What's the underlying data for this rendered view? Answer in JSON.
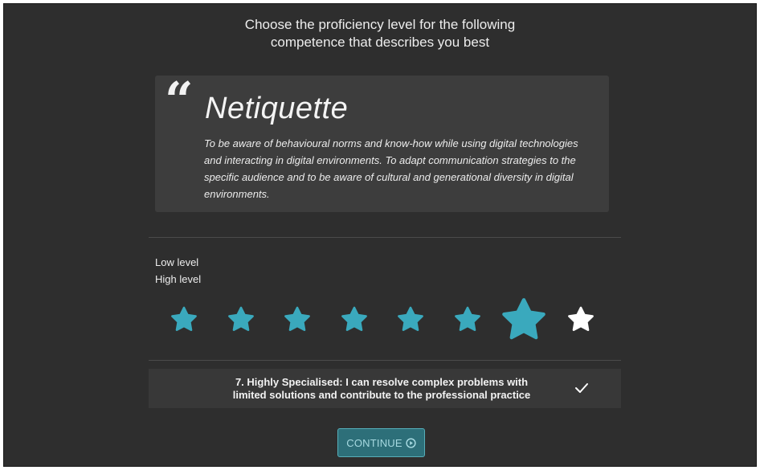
{
  "heading": {
    "line1": "Choose the proficiency level for the following",
    "line2": "competence that describes you best"
  },
  "competence": {
    "quote_icon": "quote-icon",
    "title": "Netiquette",
    "description": "To be aware of behavioural norms and know-how while using digital technologies and interacting in digital environments. To adapt communication strategies to the specific audience and to be aware of cultural and generational diversity in digital environments."
  },
  "scale": {
    "low_label": "Low level",
    "high_label": "High level",
    "total_stars": 8,
    "selected_level": 7,
    "filled_color": "#3aa9bd",
    "unfilled_color": "#ffffff"
  },
  "selection": {
    "text_line1": "7. Highly Specialised: I can resolve complex problems with",
    "text_line2": "limited solutions and contribute to the professional practice",
    "check_icon": "check-icon"
  },
  "continue_button": {
    "label": "CONTINUE",
    "icon": "play-circle-icon"
  }
}
